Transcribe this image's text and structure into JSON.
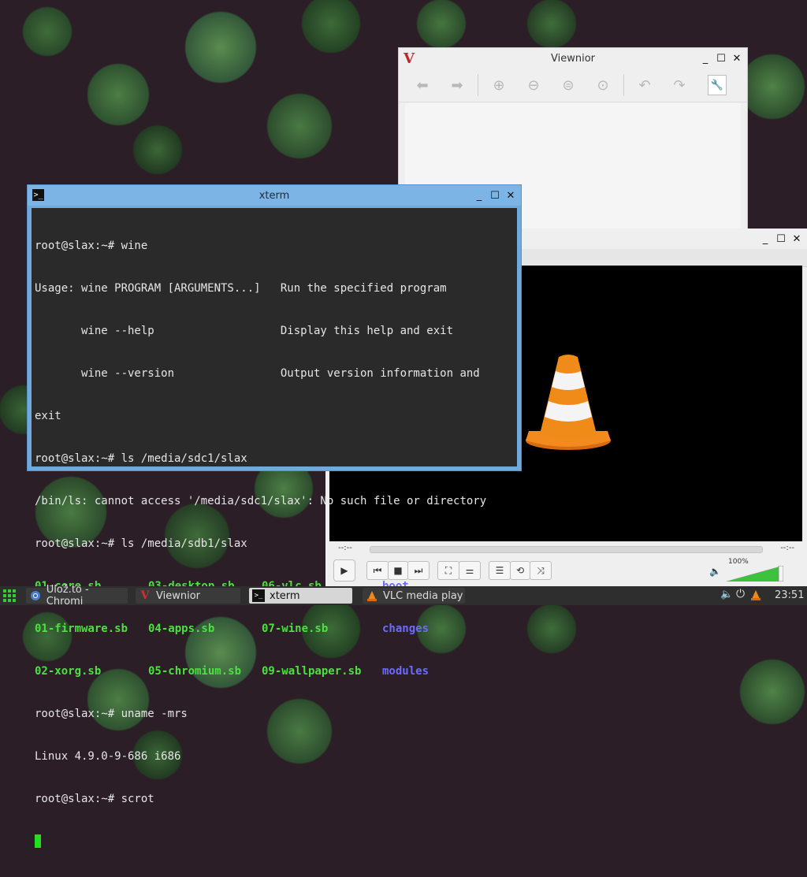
{
  "viewnior": {
    "title": "Viewnior",
    "logo": "V",
    "toolbar": [
      "back-arrow-icon",
      "forward-arrow-icon",
      "zoom-in-icon",
      "zoom-out-icon",
      "zoom-normal-icon",
      "zoom-fit-icon",
      "rotate-left-icon",
      "rotate-right-icon",
      "properties-icon"
    ]
  },
  "vlc": {
    "time_left": "--:--",
    "time_right": "--:--",
    "volume": "100%",
    "volume_level": 1.0
  },
  "xterm": {
    "title": "xterm",
    "lines": [
      "root@slax:~# wine",
      "Usage: wine PROGRAM [ARGUMENTS...]   Run the specified program",
      "       wine --help                   Display this help and exit",
      "       wine --version                Output version information and",
      "exit",
      "root@slax:~# ls /media/sdc1/slax",
      "/bin/ls: cannot access '/media/sdc1/slax': No such file or directory",
      "root@slax:~# ls /media/sdb1/slax"
    ],
    "ls_rows": [
      [
        "01-core.sb",
        "03-desktop.sb",
        "06-vlc.sb",
        "boot"
      ],
      [
        "01-firmware.sb",
        "04-apps.sb",
        "07-wine.sb",
        "changes"
      ],
      [
        "02-xorg.sb",
        "05-chromium.sb",
        "09-wallpaper.sb",
        "modules"
      ]
    ],
    "after": [
      "root@slax:~# uname -mrs",
      "Linux 4.9.0-9-686 i686",
      "root@slax:~# scrot"
    ]
  },
  "taskbar": {
    "tasks": [
      {
        "label": "Ulož.to - Chromi",
        "icon": "chromium-icon"
      },
      {
        "label": "Viewnior",
        "icon": "viewnior-icon"
      },
      {
        "label": "xterm",
        "icon": "terminal-icon"
      },
      {
        "label": "VLC media play",
        "icon": "vlc-icon"
      }
    ],
    "clock": "23:51"
  }
}
